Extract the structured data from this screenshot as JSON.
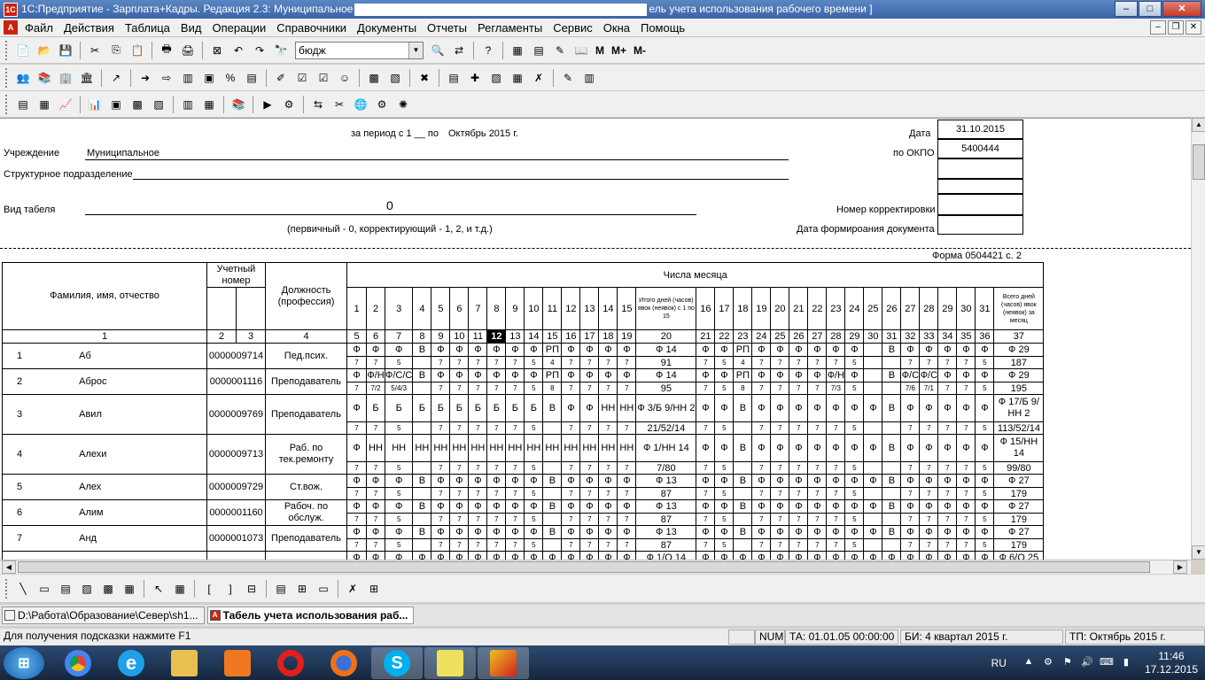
{
  "window": {
    "title_prefix": "1С:Предприятие - Зарплата+Кадры. Редакция 2.3: Муниципальное",
    "title_suffix": "ель учета использования рабочего времени ]",
    "btn_min": "–",
    "btn_max": "□",
    "btn_close": "✕"
  },
  "menu": [
    "Файл",
    "Действия",
    "Таблица",
    "Вид",
    "Операции",
    "Справочники",
    "Документы",
    "Отчеты",
    "Регламенты",
    "Сервис",
    "Окна",
    "Помощь"
  ],
  "toolbar": {
    "search_value": "бюдж",
    "m_label": "M",
    "mplus_label": "M+",
    "mminus_label": "M-"
  },
  "doc": {
    "period_label": "за период с 1 __ по",
    "period_value": "Октябрь 2015 г.",
    "date_label": "Дата",
    "date_value": "31.10.2015",
    "okpo_label": "по ОКПО",
    "okpo_value": "5400444",
    "institution_label": "Учреждение",
    "institution_value": "Муниципальное",
    "subdivision_label": "Структурное подразделение",
    "type_label": "Вид табеля",
    "type_value": "0",
    "type_hint": "(первичный - 0, корректирующий - 1, 2, и т.д.)",
    "corr_label": "Номер корректировки",
    "formed_label": "Дата формироания документа",
    "form_label": "Форма 0504421 с. 2"
  },
  "grid": {
    "h_fio": "Фамилия, имя, отчество",
    "h_acct": "Учетный номер",
    "h_pos": "Должность (профессия)",
    "h_days": "Числа месяца",
    "h_total15": "Итого дней (часов) явок (неявок) с 1 по 15",
    "h_total": "Всего дней (часов) явок (неявок) за месяц",
    "colnums": [
      "1",
      "2",
      "3",
      "4",
      "5",
      "6",
      "7",
      "8",
      "9",
      "10",
      "11",
      "12",
      "13",
      "14",
      "15",
      "16",
      "17",
      "18",
      "19",
      "20",
      "21",
      "22",
      "23",
      "24",
      "25",
      "26",
      "27",
      "28",
      "29",
      "30",
      "31",
      "32",
      "33",
      "34",
      "35",
      "36",
      "37"
    ],
    "rows": [
      {
        "n": "1",
        "fio": "Аб",
        "acct": "0000009714",
        "pos": "Пед.псих.",
        "c1": "Ф Ф Ф В Ф Ф Ф Ф Ф Ф РП Ф Ф Ф Ф",
        "t1": "Ф 14",
        "c2": "Ф Ф РП Ф Ф Ф Ф Ф Ф _ В Ф Ф Ф Ф Ф",
        "t2": "Ф 29",
        "h1": "7 7 5 _ 7 7 7 7 7 5 4 7 7 7 7",
        "r1": "91",
        "h2": "7 5 4 7 7 7 7 7 5 _ _ 7 7 7 7 5",
        "r2": "187"
      },
      {
        "n": "2",
        "fio": "Аброс",
        "acct": "0000001116",
        "pos": "Преподаватель",
        "c1": "Ф Ф/Н Ф/С/С В Ф Ф Ф Ф Ф Ф РП Ф Ф Ф Ф",
        "t1": "Ф 14",
        "c2": "Ф Ф РП Ф Ф Ф Ф Ф/Н Ф _ В Ф/С Ф/С Ф Ф Ф",
        "t2": "Ф 29",
        "h1": "7 7/2 5/4/3 _ 7 7 7 7 7 5 8 7 7 7 7",
        "r1": "95",
        "h2": "7 5 8 7 7 7 7 7/3 5 _ _ 7/6 7/1 7 7 5",
        "r2": "195"
      },
      {
        "n": "3",
        "fio": "Авил",
        "acct": "0000009769",
        "pos": "Преподаватель",
        "c1": "Ф Б Б Б Б Б Б Б Б Б В Ф Ф НН НН",
        "t1": "Ф 3/Б 9/НН 2",
        "c2": "Ф Ф В Ф Ф Ф Ф Ф Ф Ф В Ф Ф Ф Ф Ф",
        "t2": "Ф 17/Б 9/НН 2",
        "h1": "7 7 5 _ 7 7 7 7 7 5 _ 7 7 7 7",
        "r1": "21/52/14",
        "h2": "7 5 _ 7 7 7 7 7 5 _ _ 7 7 7 7 5",
        "r2": "113/52/14"
      },
      {
        "n": "4",
        "fio": "Алехи",
        "acct": "0000009713",
        "pos": "Раб. по тек.ремонту",
        "c1": "Ф НН НН НН НН НН НН НН НН НН НН НН НН НН НН",
        "t1": "Ф 1/НН 14",
        "c2": "Ф Ф В Ф Ф Ф Ф Ф Ф Ф В Ф Ф Ф Ф Ф",
        "t2": "Ф 15/НН 14",
        "h1": "7 7 5 _ 7 7 7 7 7 5 _ 7 7 7 7",
        "r1": "7/80",
        "h2": "7 5 _ 7 7 7 7 7 5 _ _ 7 7 7 7 5",
        "r2": "99/80"
      },
      {
        "n": "5",
        "fio": "Алех",
        "acct": "0000009729",
        "pos": "Ст.вож.",
        "c1": "Ф Ф Ф В Ф Ф Ф Ф Ф Ф В Ф Ф Ф Ф",
        "t1": "Ф 13",
        "c2": "Ф Ф В Ф Ф Ф Ф Ф Ф Ф В Ф Ф Ф Ф Ф",
        "t2": "Ф 27",
        "h1": "7 7 5 _ 7 7 7 7 7 5 _ 7 7 7 7",
        "r1": "87",
        "h2": "7 5 _ 7 7 7 7 7 5 _ _ 7 7 7 7 5",
        "r2": "179"
      },
      {
        "n": "6",
        "fio": "Алим",
        "acct": "0000001160",
        "pos": "Рабоч. по обслуж.",
        "c1": "Ф Ф Ф В Ф Ф Ф Ф Ф Ф В Ф Ф Ф Ф",
        "t1": "Ф 13",
        "c2": "Ф Ф В Ф Ф Ф Ф Ф Ф Ф В Ф Ф Ф Ф Ф",
        "t2": "Ф 27",
        "h1": "7 7 5 _ 7 7 7 7 7 5 _ 7 7 7 7",
        "r1": "87",
        "h2": "7 5 _ 7 7 7 7 7 5 _ _ 7 7 7 7 5",
        "r2": "179"
      },
      {
        "n": "7",
        "fio": "Анд",
        "acct": "0000001073",
        "pos": "Преподаватель",
        "c1": "Ф Ф Ф В Ф Ф Ф Ф Ф Ф В Ф Ф Ф Ф",
        "t1": "Ф 13",
        "c2": "Ф Ф В Ф Ф Ф Ф Ф Ф Ф В Ф Ф Ф Ф Ф",
        "t2": "Ф 27",
        "h1": "7 7 5 _ 7 7 7 7 7 5 _ 7 7 7 7",
        "r1": "87",
        "h2": "7 5 _ 7 7 7 7 7 5 _ _ 7 7 7 7 5",
        "r2": "179"
      }
    ],
    "partial": {
      "c1": "Ф Ф Ф Ф Ф Ф Ф Ф Ф Ф Ф Ф Ф Ф Ф",
      "t1": "Ф 1/О 14",
      "c2": "Ф Ф Ф Ф Ф Ф Ф Ф Ф Ф Ф Ф Ф Ф Ф Ф",
      "t2": "Ф 6/О 25"
    }
  },
  "windows": [
    {
      "label": "D:\\Работа\\Образование\\Север\\sh1...",
      "active": false
    },
    {
      "label": "Табель учета использования раб...",
      "active": true
    }
  ],
  "status": {
    "hint": "Для получения подсказки нажмите F1",
    "num": "NUM",
    "ta": "ТА: 01.01.05  00:00:00",
    "bi": "БИ: 4 квартал 2015 г.",
    "tp": "ТП: Октябрь 2015 г."
  },
  "tray": {
    "lang": "RU",
    "time": "11:46",
    "date": "17.12.2015"
  }
}
